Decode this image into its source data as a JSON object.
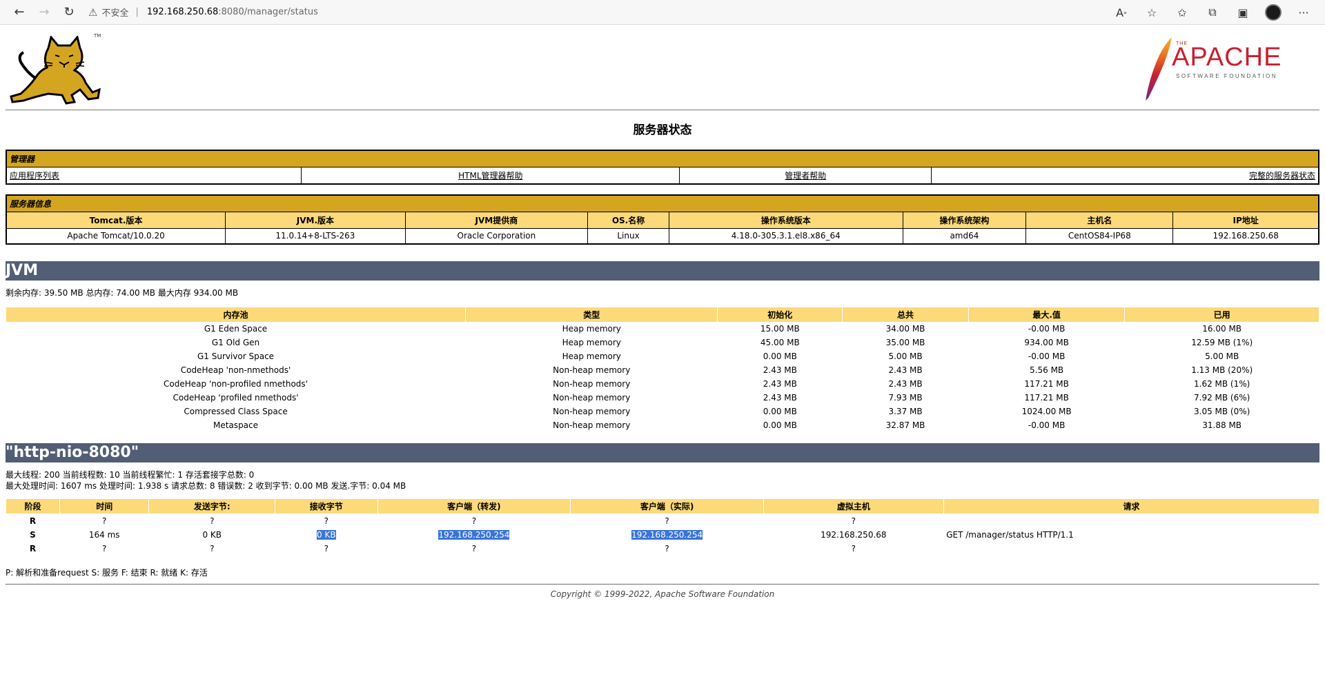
{
  "browser": {
    "insecure_label": "不安全",
    "separator": "|",
    "url_host": "192.168.250.68",
    "url_rest": ":8080/manager/status"
  },
  "page": {
    "title": "服务器状态",
    "apache_the": "THE",
    "apache_name": "APACHE",
    "apache_sub": "SOFTWARE FOUNDATION",
    "tomcat_tm": "TM"
  },
  "manager": {
    "title": "管理器",
    "links": [
      "应用程序列表",
      "HTML管理器帮助",
      "管理者帮助",
      "完整的服务器状态"
    ]
  },
  "server_info": {
    "title": "服务器信息",
    "headers": [
      "Tomcat.版本",
      "JVM.版本",
      "JVM提供商",
      "OS.名称",
      "操作系统版本",
      "操作系统架构",
      "主机名",
      "IP地址"
    ],
    "values": [
      "Apache Tomcat/10.0.20",
      "11.0.14+8-LTS-263",
      "Oracle Corporation",
      "Linux",
      "4.18.0-305.3.1.el8.x86_64",
      "amd64",
      "CentOS84-IP68",
      "192.168.250.68"
    ]
  },
  "jvm": {
    "title": "JVM",
    "memory_line": "剩余内存:  39.50 MB 总内存:  74.00 MB 最大内存 934.00 MB",
    "headers": [
      "内存池",
      "类型",
      "初始化",
      "总共",
      "最大.值",
      "已用"
    ],
    "rows": [
      [
        "G1 Eden Space",
        "Heap memory",
        "15.00 MB",
        "34.00 MB",
        "-0.00 MB",
        "16.00 MB"
      ],
      [
        "G1 Old Gen",
        "Heap memory",
        "45.00 MB",
        "35.00 MB",
        "934.00 MB",
        "12.59 MB (1%)"
      ],
      [
        "G1 Survivor Space",
        "Heap memory",
        "0.00 MB",
        "5.00 MB",
        "-0.00 MB",
        "5.00 MB"
      ],
      [
        "CodeHeap 'non-nmethods'",
        "Non-heap memory",
        "2.43 MB",
        "2.43 MB",
        "5.56 MB",
        "1.13 MB (20%)"
      ],
      [
        "CodeHeap 'non-profiled nmethods'",
        "Non-heap memory",
        "2.43 MB",
        "2.43 MB",
        "117.21 MB",
        "1.62 MB (1%)"
      ],
      [
        "CodeHeap 'profiled nmethods'",
        "Non-heap memory",
        "2.43 MB",
        "7.93 MB",
        "117.21 MB",
        "7.92 MB (6%)"
      ],
      [
        "Compressed Class Space",
        "Non-heap memory",
        "0.00 MB",
        "3.37 MB",
        "1024.00 MB",
        "3.05 MB (0%)"
      ],
      [
        "Metaspace",
        "Non-heap memory",
        "0.00 MB",
        "32.87 MB",
        "-0.00 MB",
        "31.88 MB"
      ]
    ]
  },
  "connector": {
    "title": "\"http-nio-8080\"",
    "line1": "最大线程:  200 当前线程数:  10 当前线程繁忙:  1 存活套接字总数:  0",
    "line2": "最大处理时间:  1607 ms 处理时间:  1.938 s 请求总数:  8 错误数:  2 收到字节:  0.00 MB 发送.字节: 0.04 MB",
    "headers": [
      "阶段",
      "时间",
      "发送字节:",
      "接收字节",
      "客户端（转发)",
      "客户端（实际)",
      "虚拟主机",
      "请求"
    ],
    "rows": [
      [
        "R",
        "?",
        "?",
        "?",
        "?",
        "?",
        "?",
        ""
      ],
      [
        "S",
        "164 ms",
        "0 KB",
        "0 KB",
        "192.168.250.254",
        "192.168.250.254",
        "192.168.250.68",
        "GET /manager/status HTTP/1.1"
      ],
      [
        "R",
        "?",
        "?",
        "?",
        "?",
        "?",
        "?",
        ""
      ]
    ],
    "legend": "P:  解析和准备request S:  服务 F:  结束 R:  就绪 K:  存活"
  },
  "footer": {
    "copyright": "Copyright © 1999-2022, Apache Software Foundation"
  }
}
